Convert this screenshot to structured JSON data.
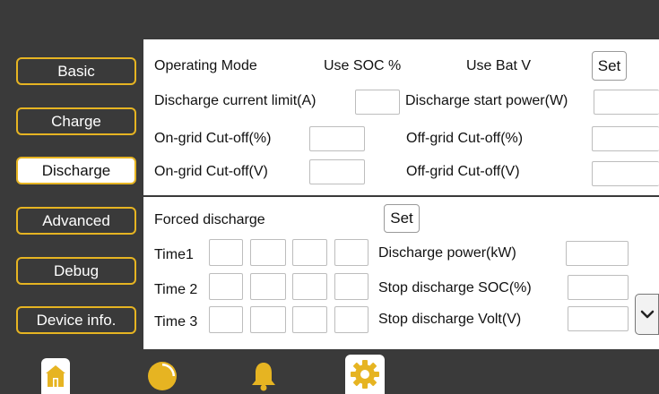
{
  "sidebar": {
    "items": [
      {
        "label": "Basic"
      },
      {
        "label": "Charge"
      },
      {
        "label": "Discharge"
      },
      {
        "label": "Advanced"
      },
      {
        "label": "Debug"
      },
      {
        "label": "Device info."
      }
    ],
    "selected": "Discharge"
  },
  "top": {
    "operating_mode": "Operating Mode",
    "use_soc": "Use SOC %",
    "use_bat_v": "Use Bat V",
    "set_label": "Set",
    "discharge_current_limit": "Discharge current limit(A)",
    "discharge_start_power": "Discharge start power(W)",
    "ongrid_cutoff_pct": "On-grid Cut-off(%)",
    "offgrid_cutoff_pct": "Off-grid Cut-off(%)",
    "ongrid_cutoff_v": "On-grid Cut-off(V)",
    "offgrid_cutoff_v": "Off-grid Cut-off(V)"
  },
  "bottom": {
    "forced_discharge": "Forced discharge",
    "set_label": "Set",
    "time1": "Time1",
    "time2": "Time 2",
    "time3": "Time 3",
    "discharge_power": "Discharge power(kW)",
    "stop_soc": "Stop discharge SOC(%)",
    "stop_volt": "Stop discharge Volt(V)"
  },
  "nav": {
    "icons": [
      "home-icon",
      "pie-chart-icon",
      "bell-icon",
      "gear-icon"
    ],
    "active": "gear-icon"
  },
  "colors": {
    "accent": "#e6b422",
    "background": "#3a3a3a",
    "panel": "#ffffff"
  }
}
